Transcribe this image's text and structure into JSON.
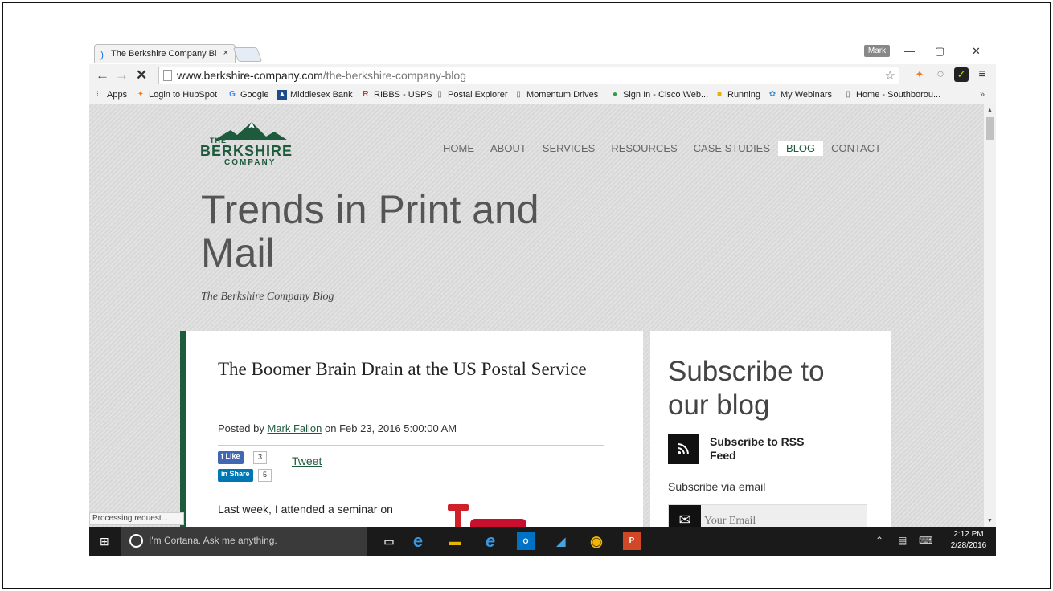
{
  "browser": {
    "tab_title": "The Berkshire Company Bl",
    "tab_close": "×",
    "profile": "Mark",
    "window_minimize": "—",
    "window_restore": "▢",
    "window_close": "✕",
    "url_host": "www.berkshire-company.com",
    "url_path": "/the-berkshire-company-blog",
    "bookmarks": [
      {
        "label": "Apps",
        "icon": "apps-grid-icon"
      },
      {
        "label": "Login to HubSpot",
        "icon": "hubspot-icon"
      },
      {
        "label": "Google",
        "icon": "google-icon"
      },
      {
        "label": "Middlesex Bank",
        "icon": "bank-icon"
      },
      {
        "label": "RIBBS - USPS",
        "icon": "usps-icon"
      },
      {
        "label": "Postal Explorer",
        "icon": "page-icon"
      },
      {
        "label": "Momentum Drives",
        "icon": "page-icon"
      },
      {
        "label": "Sign In - Cisco Web...",
        "icon": "globe-icon"
      },
      {
        "label": "Running",
        "icon": "folder-icon"
      },
      {
        "label": "My Webinars",
        "icon": "webinar-icon"
      },
      {
        "label": "Home - Southborou...",
        "icon": "page-icon"
      }
    ],
    "bookmarks_overflow": "»",
    "status_text": "Processing request..."
  },
  "site": {
    "logo": {
      "line1": "THE",
      "line2": "BERKSHIRE",
      "line3": "COMPANY"
    },
    "nav": [
      {
        "label": "HOME",
        "active": false
      },
      {
        "label": "ABOUT",
        "active": false
      },
      {
        "label": "SERVICES",
        "active": false
      },
      {
        "label": "RESOURCES",
        "active": false
      },
      {
        "label": "CASE STUDIES",
        "active": false
      },
      {
        "label": "BLOG",
        "active": true
      },
      {
        "label": "CONTACT",
        "active": false
      }
    ],
    "page_title": "Trends in Print and Mail",
    "page_subtitle": "The Berkshire Company Blog",
    "brand_color": "#1e5b3c"
  },
  "post": {
    "title": "The Boomer Brain Drain at the US Postal Service",
    "byline_prefix": "Posted by",
    "author": "Mark Fallon",
    "byline_suffix": "on Feb 23, 2016 5:00:00 AM",
    "fb_label": "Like",
    "fb_count": "3",
    "tweet_label": "Tweet",
    "li_label": "Share",
    "li_count": "5",
    "excerpt": "Last week, I attended a seminar on"
  },
  "sidebar": {
    "heading": "Subscribe to our blog",
    "rss_label": "Subscribe to RSS Feed",
    "via_email": "Subscribe via email",
    "email_placeholder": "Your Email"
  },
  "taskbar": {
    "cortana_text": "I'm Cortana. Ask me anything.",
    "time": "2:12 PM",
    "date": "2/28/2016"
  }
}
